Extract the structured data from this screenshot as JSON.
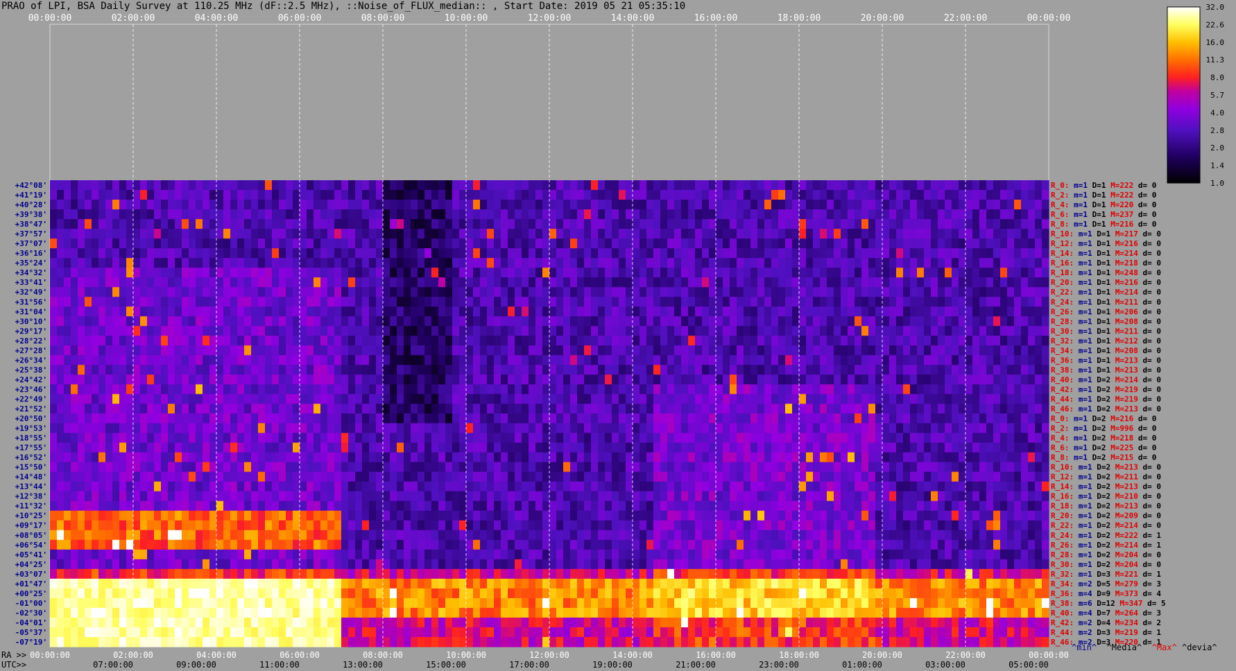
{
  "title": "PRAO of LPI, BSA Daily Survey at 110.25 MHz (dF::2.5 MHz), ::Noise_of_FLUX_median:: , Start Date: 2019 05 21 05:35:10",
  "chart_data": {
    "type": "heatmap",
    "title": "PRAO of LPI, BSA Daily Survey at 110.25 MHz (dF::2.5 MHz), ::Noise_of_FLUX_median:: , Start Date: 2019 05 21 05:35:10",
    "x_top_ticks": [
      "00:00:00",
      "02:00:00",
      "04:00:00",
      "06:00:00",
      "08:00:00",
      "10:00:00",
      "12:00:00",
      "14:00:00",
      "16:00:00",
      "18:00:00",
      "20:00:00",
      "22:00:00",
      "00:00:00"
    ],
    "x_bottom_ra_label": "RA >>",
    "x_bottom_ra_ticks": [
      "00:00:00",
      "02:00:00",
      "04:00:00",
      "06:00:00",
      "08:00:00",
      "10:00:00",
      "12:00:00",
      "14:00:00",
      "16:00:00",
      "18:00:00",
      "20:00:00",
      "22:00:00",
      "00:00:00"
    ],
    "x_bottom_utc_label": "UTC>>",
    "x_bottom_utc_ticks": [
      "07:00:00",
      "09:00:00",
      "11:00:00",
      "13:00:00",
      "15:00:00",
      "17:00:00",
      "19:00:00",
      "21:00:00",
      "23:00:00",
      "01:00:00",
      "03:00:00",
      "05:00:00"
    ],
    "y_ticks": [
      "+42°08'",
      "+41°19'",
      "+40°28'",
      "+39°38'",
      "+38°47'",
      "+37°57'",
      "+37°07'",
      "+36°16'",
      "+35°24'",
      "+34°32'",
      "+33°41'",
      "+32°49'",
      "+31°56'",
      "+31°04'",
      "+30°10'",
      "+29°17'",
      "+28°22'",
      "+27°28'",
      "+26°34'",
      "+25°38'",
      "+24°42'",
      "+23°46'",
      "+22°49'",
      "+21°52'",
      "+20°50'",
      "+19°53'",
      "+18°55'",
      "+17°55'",
      "+16°52'",
      "+15°50'",
      "+14°48'",
      "+13°44'",
      "+12°38'",
      "+11°32'",
      "+10°25'",
      "+09°17'",
      "+08°05'",
      "+06°54'",
      "+05°41'",
      "+04°25'",
      "+03°07'",
      "+01°47'",
      "+00°25'",
      "-01°00'",
      "-02°30'",
      "-04°01'",
      "-05°37'",
      "-07°19'"
    ],
    "colorbar": {
      "ticks": [
        32.0,
        22.6,
        16.0,
        11.3,
        8.0,
        5.7,
        4.0,
        2.8,
        2.0,
        1.4,
        1.0
      ],
      "scale": "log",
      "colors": [
        "#ffffff",
        "#ffff80",
        "#ffd000",
        "#ff8000",
        "#ff2000",
        "#c00040",
        "#b000b0",
        "#8000e0",
        "#4000c0",
        "#200060",
        "#000000"
      ]
    },
    "row_stats": [
      {
        "r": "R_0:",
        "m": "m=1",
        "d": "D=1",
        "M": "M=222",
        "dev": "d= 0"
      },
      {
        "r": "R_2:",
        "m": "m=1",
        "d": "D=1",
        "M": "M=222",
        "dev": "d= 0"
      },
      {
        "r": "R_4:",
        "m": "m=1",
        "d": "D=1",
        "M": "M=220",
        "dev": "d= 0"
      },
      {
        "r": "R_6:",
        "m": "m=1",
        "d": "D=1",
        "M": "M=237",
        "dev": "d= 0"
      },
      {
        "r": "R_8:",
        "m": "m=1",
        "d": "D=1",
        "M": "M=216",
        "dev": "d= 0"
      },
      {
        "r": "R_10:",
        "m": "m=1",
        "d": "D=1",
        "M": "M=217",
        "dev": "d= 0"
      },
      {
        "r": "R_12:",
        "m": "m=1",
        "d": "D=1",
        "M": "M=216",
        "dev": "d= 0"
      },
      {
        "r": "R_14:",
        "m": "m=1",
        "d": "D=1",
        "M": "M=214",
        "dev": "d= 0"
      },
      {
        "r": "R_16:",
        "m": "m=1",
        "d": "D=1",
        "M": "M=218",
        "dev": "d= 0"
      },
      {
        "r": "R_18:",
        "m": "m=1",
        "d": "D=1",
        "M": "M=248",
        "dev": "d= 0"
      },
      {
        "r": "R_20:",
        "m": "m=1",
        "d": "D=1",
        "M": "M=216",
        "dev": "d= 0"
      },
      {
        "r": "R_22:",
        "m": "m=1",
        "d": "D=1",
        "M": "M=214",
        "dev": "d= 0"
      },
      {
        "r": "R_24:",
        "m": "m=1",
        "d": "D=1",
        "M": "M=211",
        "dev": "d= 0"
      },
      {
        "r": "R_26:",
        "m": "m=1",
        "d": "D=1",
        "M": "M=206",
        "dev": "d= 0"
      },
      {
        "r": "R_28:",
        "m": "m=1",
        "d": "D=1",
        "M": "M=208",
        "dev": "d= 0"
      },
      {
        "r": "R_30:",
        "m": "m=1",
        "d": "D=1",
        "M": "M=211",
        "dev": "d= 0"
      },
      {
        "r": "R_32:",
        "m": "m=1",
        "d": "D=1",
        "M": "M=212",
        "dev": "d= 0"
      },
      {
        "r": "R_34:",
        "m": "m=1",
        "d": "D=1",
        "M": "M=208",
        "dev": "d= 0"
      },
      {
        "r": "R_36:",
        "m": "m=1",
        "d": "D=1",
        "M": "M=213",
        "dev": "d= 0"
      },
      {
        "r": "R_38:",
        "m": "m=1",
        "d": "D=1",
        "M": "M=213",
        "dev": "d= 0"
      },
      {
        "r": "R_40:",
        "m": "m=1",
        "d": "D=2",
        "M": "M=214",
        "dev": "d= 0"
      },
      {
        "r": "R_42:",
        "m": "m=1",
        "d": "D=2",
        "M": "M=219",
        "dev": "d= 0"
      },
      {
        "r": "R_44:",
        "m": "m=1",
        "d": "D=2",
        "M": "M=219",
        "dev": "d= 0"
      },
      {
        "r": "R_46:",
        "m": "m=1",
        "d": "D=2",
        "M": "M=213",
        "dev": "d= 0"
      },
      {
        "r": "R_0:",
        "m": "m=1",
        "d": "D=2",
        "M": "M=216",
        "dev": "d= 0"
      },
      {
        "r": "R_2:",
        "m": "m=1",
        "d": "D=2",
        "M": "M=996",
        "dev": "d= 0"
      },
      {
        "r": "R_4:",
        "m": "m=1",
        "d": "D=2",
        "M": "M=218",
        "dev": "d= 0"
      },
      {
        "r": "R_6:",
        "m": "m=1",
        "d": "D=2",
        "M": "M=225",
        "dev": "d= 0"
      },
      {
        "r": "R_8:",
        "m": "m=1",
        "d": "D=2",
        "M": "M=215",
        "dev": "d= 0"
      },
      {
        "r": "R_10:",
        "m": "m=1",
        "d": "D=2",
        "M": "M=213",
        "dev": "d= 0"
      },
      {
        "r": "R_12:",
        "m": "m=1",
        "d": "D=2",
        "M": "M=211",
        "dev": "d= 0"
      },
      {
        "r": "R_14:",
        "m": "m=1",
        "d": "D=2",
        "M": "M=213",
        "dev": "d= 0"
      },
      {
        "r": "R_16:",
        "m": "m=1",
        "d": "D=2",
        "M": "M=210",
        "dev": "d= 0"
      },
      {
        "r": "R_18:",
        "m": "m=1",
        "d": "D=2",
        "M": "M=213",
        "dev": "d= 0"
      },
      {
        "r": "R_20:",
        "m": "m=1",
        "d": "D=2",
        "M": "M=209",
        "dev": "d= 0"
      },
      {
        "r": "R_22:",
        "m": "m=1",
        "d": "D=2",
        "M": "M=214",
        "dev": "d= 0"
      },
      {
        "r": "R_24:",
        "m": "m=1",
        "d": "D=2",
        "M": "M=222",
        "dev": "d= 1"
      },
      {
        "r": "R_26:",
        "m": "m=1",
        "d": "D=2",
        "M": "M=214",
        "dev": "d= 1"
      },
      {
        "r": "R_28:",
        "m": "m=1",
        "d": "D=2",
        "M": "M=204",
        "dev": "d= 0"
      },
      {
        "r": "R_30:",
        "m": "m=1",
        "d": "D=2",
        "M": "M=204",
        "dev": "d= 0"
      },
      {
        "r": "R_32:",
        "m": "m=1",
        "d": "D=3",
        "M": "M=221",
        "dev": "d= 1"
      },
      {
        "r": "R_34:",
        "m": "m=2",
        "d": "D=5",
        "M": "M=279",
        "dev": "d= 3"
      },
      {
        "r": "R_36:",
        "m": "m=4",
        "d": "D=9",
        "M": "M=373",
        "dev": "d= 4"
      },
      {
        "r": "R_38:",
        "m": "m=6",
        "d": "D=12",
        "M": "M=347",
        "dev": "d= 5"
      },
      {
        "r": "R_40:",
        "m": "m=4",
        "d": "D=7",
        "M": "M=264",
        "dev": "d= 3"
      },
      {
        "r": "R_42:",
        "m": "m=2",
        "d": "D=4",
        "M": "M=234",
        "dev": "d= 2"
      },
      {
        "r": "R_44:",
        "m": "m=2",
        "d": "D=3",
        "M": "M=219",
        "dev": "d= 1"
      },
      {
        "r": "R_46:",
        "m": "m=2",
        "d": "D=3",
        "M": "M=220",
        "dev": "d= 1"
      }
    ],
    "stats_legend": {
      "min": "^min^",
      "median": "^Media^",
      "max": "^Max^",
      "dev": "^devia^"
    }
  }
}
